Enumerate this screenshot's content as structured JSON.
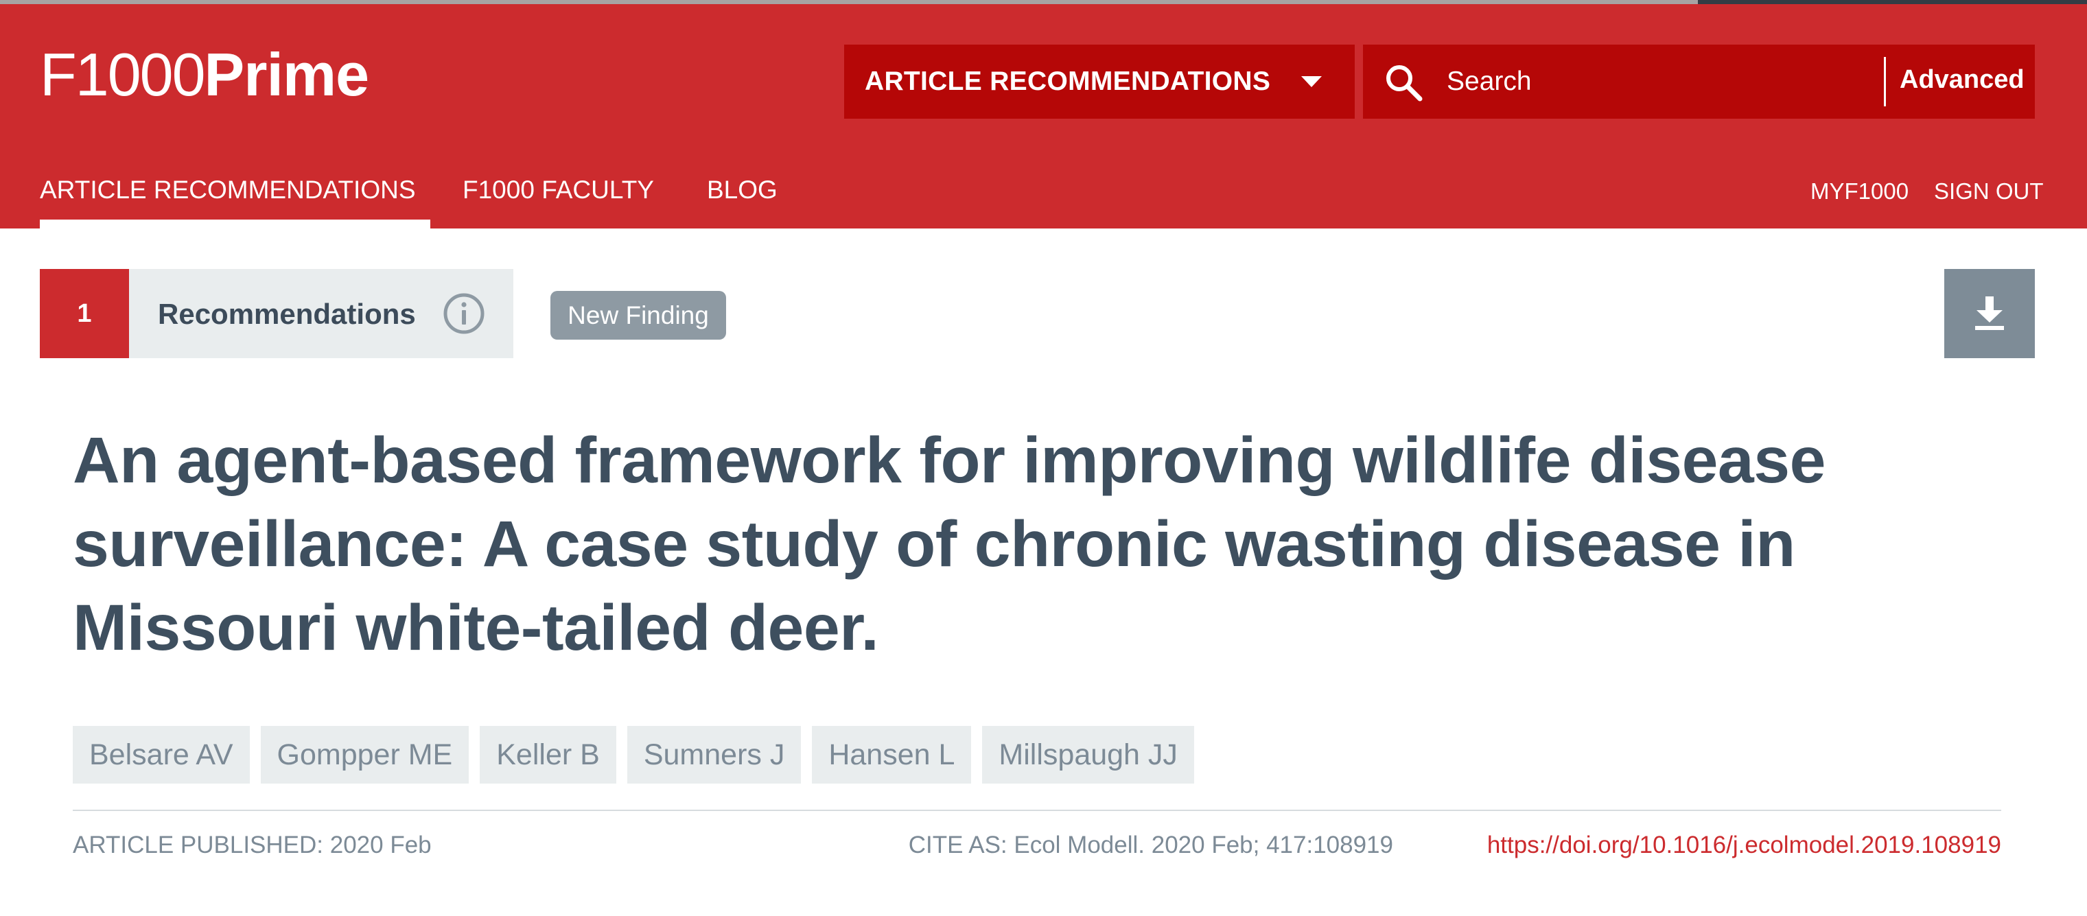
{
  "brand": {
    "logo_thin": "F1000",
    "logo_bold": "Prime"
  },
  "header": {
    "dropdown_label": "ARTICLE RECOMMENDATIONS",
    "search_placeholder": "Search",
    "advanced_label": "Advanced"
  },
  "nav": {
    "items": [
      {
        "label": "ARTICLE RECOMMENDATIONS",
        "active": true
      },
      {
        "label": "F1000 FACULTY",
        "active": false
      },
      {
        "label": "BLOG",
        "active": false
      }
    ],
    "right_items": [
      {
        "label": "MYF1000"
      },
      {
        "label": "SIGN OUT"
      }
    ]
  },
  "recommendations": {
    "count": "1",
    "label": "Recommendations"
  },
  "badge": {
    "label": "New Finding"
  },
  "article": {
    "title": "An agent-based framework for improving wildlife disease surveillance: A case study of chronic wasting disease in Missouri white-tailed deer.",
    "authors": [
      "Belsare AV",
      "Gompper ME",
      "Keller B",
      "Sumners J",
      "Hansen L",
      "Millspaugh JJ"
    ],
    "published": "ARTICLE PUBLISHED: 2020 Feb",
    "cite": "CITE AS: Ecol Modell. 2020 Feb; 417:108919",
    "doi": "https://doi.org/10.1016/j.ecolmodel.2019.108919"
  },
  "colors": {
    "brand_red": "#cc2b2e",
    "dark_red": "#b50707",
    "title_text": "#3e4f5f",
    "muted_text": "#7c8a96",
    "chip_bg": "#e9edee"
  },
  "icons": [
    "search-icon",
    "chevron-down-icon",
    "info-icon",
    "download-icon"
  ]
}
